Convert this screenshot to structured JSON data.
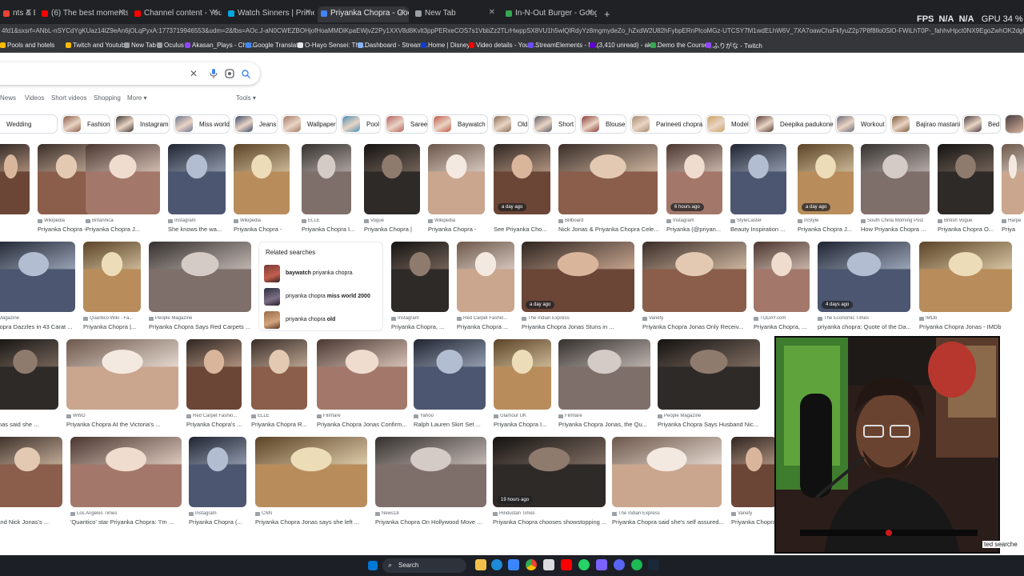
{
  "browser": {
    "tabs": [
      {
        "title": "nts & Boo",
        "color": "#ea4335",
        "active": false
      },
      {
        "title": "(6) The best moments from the",
        "color": "#ff0000",
        "active": false
      },
      {
        "title": "Channel content - YouTube Stu",
        "color": "#ff0000",
        "active": false
      },
      {
        "title": "Watch Sinners | Prime Video",
        "color": "#00a8e1",
        "active": false
      },
      {
        "title": "Priyanka Chopra - Google Sear",
        "color": "#4285f4",
        "active": true
      },
      {
        "title": "New Tab",
        "color": "#9aa0a6",
        "active": false
      },
      {
        "title": "In-N-Out Burger - Google Ma",
        "color": "#34a853",
        "active": false
      }
    ],
    "new_tab_glyph": "+",
    "fps_label": "FPS",
    "fps_value": "N/A",
    "fps_value2": "N/A",
    "gpu_label": "GPU",
    "gpu_value": "34 %",
    "url": "4fd1&sxsrf=ANbL-nSYCdYgKUaz14lZ9eAn6jOLqPyxA:1773719946553&udm=2&fbs=AOc.J-aN0CWEZBOHjofHoaMMDiKpaEWjvZ2Py1XXV8d8Kvlt3ppPERxeCOS7s1VbbZz2TLrHwppSX8VU1h5wlQlRdyYz8mgmydeZo_hZxdW2U82hFybpERnPlcoMGz-UTCSY7M1wdELhW6V_7XA7oawChsFkfyuZ2p7P8f8llo0SlO-FWiLhT0P-_fahhvHpct0NX9EgoZwhOK2dgF2K9Nl8u8b_MvHbkQ8q=Priyanka+Chopra&sa=X&sqi=2&ved=2ahUKE",
    "bookmarks": [
      {
        "label": "Pools and hotels",
        "color": "#fbbc04"
      },
      {
        "label": "Twitch and Youtub...",
        "color": "#fbbc04"
      },
      {
        "label": "New Tab",
        "color": "#9aa0a6"
      },
      {
        "label": "Oculus",
        "color": "#9aa0a6"
      },
      {
        "label": "Akasan_Plays - Chat...",
        "color": "#9146ff"
      },
      {
        "label": "Google Translate",
        "color": "#4285f4"
      },
      {
        "label": "O-Hayo Sensei: The...",
        "color": "#e8eaed"
      },
      {
        "label": "Dashboard - Stream...",
        "color": "#8ab4f8"
      },
      {
        "label": "Home | Disney+",
        "color": "#113ccf"
      },
      {
        "label": "Video details - YouT...",
        "color": "#ff0000"
      },
      {
        "label": "StreamElements - M...",
        "color": "#6c4ef5"
      },
      {
        "label": "(3,410 unread) - aka...",
        "color": "#6001d2"
      },
      {
        "label": "Demo the Course |...",
        "color": "#34a853"
      },
      {
        "label": "ふりがな - Twitch",
        "color": "#9146ff"
      }
    ]
  },
  "search": {
    "clear_icon": "close-icon",
    "mic_icon": "microphone-icon",
    "lens_icon": "lens-icon",
    "search_icon": "search-icon",
    "filters": [
      "News",
      "Videos",
      "Short videos",
      "Shopping",
      "More ▾"
    ],
    "tools": "Tools ▾",
    "chips": [
      "Wedding",
      "Fashion",
      "Instagram",
      "Miss world",
      "Jeans",
      "Wallpaper",
      "Pool",
      "Saree",
      "Baywatch",
      "Old",
      "Short",
      "Blouse",
      "Parineeti chopra",
      "Model",
      "Deepika padukone",
      "Workout",
      "Bajirao mastani",
      "Bed"
    ]
  },
  "results": {
    "row1": [
      {
        "src": "",
        "title": "",
        "badge": ""
      },
      {
        "src": "Wikipedia",
        "title": "Priyanka Chopra -",
        "badge": ""
      },
      {
        "src": "Britannica",
        "title": "Priyanka Chopra J...",
        "badge": ""
      },
      {
        "src": "Instagram",
        "title": "She knows the wa...",
        "badge": ""
      },
      {
        "src": "Wikipedia",
        "title": "Priyanka Chopra -",
        "badge": ""
      },
      {
        "src": "ELLE",
        "title": "Priyanka Chopra I...",
        "badge": ""
      },
      {
        "src": "Vogue",
        "title": "Priyanka Chopra |",
        "badge": ""
      },
      {
        "src": "Wikipedia",
        "title": "Priyanka Chopra -",
        "badge": ""
      },
      {
        "src": "",
        "title": "See Priyanka Cho...",
        "badge": "a day ago"
      },
      {
        "src": "Billboard",
        "title": "Nick Jonas & Priyanka Chopra Cele...",
        "badge": ""
      },
      {
        "src": "Instagram",
        "title": "Priyanka (@priyan...",
        "badge": "6 hours ago"
      },
      {
        "src": "StyleCaster",
        "title": "Beauty Inspiration ...",
        "badge": ""
      },
      {
        "src": "InStyle",
        "title": "Priyanka Chopra J...",
        "badge": "a day ago"
      },
      {
        "src": "South China Morning Post",
        "title": "How Priyanka Chopra ...",
        "badge": ""
      },
      {
        "src": "British Vogue",
        "title": "Priyanka Chopra O...",
        "badge": ""
      },
      {
        "src": "Harpe",
        "title": "Priya",
        "badge": ""
      }
    ],
    "row2": [
      {
        "src": "Magazine",
        "title": "Chopra Dazzles in 43 Carat ...",
        "badge": ""
      },
      {
        "src": "Quantico Wiki - Fa...",
        "title": "Priyanka Chopra |...",
        "badge": ""
      },
      {
        "src": "People Magazine",
        "title": "Priyanka Chopra Says Red Carpets ...",
        "badge": ""
      },
      {
        "src": "Instagram",
        "title": "Priyanka Chopra, ...",
        "badge": ""
      },
      {
        "src": "Red Carpet Fashio...",
        "title": "Priyanka Chopra ...",
        "badge": ""
      },
      {
        "src": "The Indian Express",
        "title": "Priyanka Chopra Jonas Stuns in ...",
        "badge": "a day ago"
      },
      {
        "src": "Variety",
        "title": "Priyanka Chopra Jonas Only Receiv...",
        "badge": ""
      },
      {
        "src": "TODAY.com",
        "title": "Priyanka Chopra, ...",
        "badge": ""
      },
      {
        "src": "The Economic Times",
        "title": "priyanka chopra: Quote of the Da...",
        "badge": "4 days ago"
      },
      {
        "src": "IMDb",
        "title": "Priyanka Chopra Jonas - IMDb",
        "badge": ""
      }
    ],
    "related": {
      "title": "Related searches",
      "items": [
        {
          "bold": "baywatch",
          "rest": " priyanka chopra"
        },
        {
          "pre": "priyanka chopra ",
          "bold": "miss world 2000"
        },
        {
          "pre": "priyanka chopra ",
          "bold": "old"
        }
      ]
    },
    "row3": [
      {
        "src": "",
        "title": "Jonas said she ...",
        "badge": ""
      },
      {
        "src": "WWD",
        "title": "Priyanka Chopra At the Victoria's ...",
        "badge": ""
      },
      {
        "src": "Red Carpet Fashio...",
        "title": "Priyanka Chopra's ...",
        "badge": ""
      },
      {
        "src": "ELLE",
        "title": "Priyanka Chopra R...",
        "badge": ""
      },
      {
        "src": "Filmfare",
        "title": "Priyanka Chopra Jonas Confirm...",
        "badge": ""
      },
      {
        "src": "Yahoo",
        "title": "Ralph Lauren Skirt Set ...",
        "badge": ""
      },
      {
        "src": "Glamour UK",
        "title": "Priyanka Chopra I...",
        "badge": ""
      },
      {
        "src": "Filmfare",
        "title": "Priyanka Chopra Jonas, the Qu...",
        "badge": ""
      },
      {
        "src": "People Magazine",
        "title": "Priyanka Chopra Says Husband Nic...",
        "badge": ""
      }
    ],
    "row4": [
      {
        "src": "",
        "title": "a and Nick Jonas's ...",
        "badge": ""
      },
      {
        "src": "Los Angeles Times",
        "title": "'Quantico' star Priyanka Chopra: 'I'm ...",
        "badge": ""
      },
      {
        "src": "Instagram",
        "title": "Priyanka Chopra (...",
        "badge": ""
      },
      {
        "src": "CNN",
        "title": "Priyanka Chopra Jonas says she left ...",
        "badge": ""
      },
      {
        "src": "News18",
        "title": "Priyanka Chopra On Hollywood Move ...",
        "badge": ""
      },
      {
        "src": "Hindustan Times",
        "title": "Priyanka Chopra chooses showstopping ...",
        "badge": "19 hours ago"
      },
      {
        "src": "The Indian Express",
        "title": "Priyanka Chopra said she's self assured...",
        "badge": ""
      },
      {
        "src": "Variety",
        "title": "Priyanka Chopra",
        "badge": ""
      }
    ],
    "related_peek": "ted searche"
  },
  "taskbar": {
    "search_label": "Search"
  }
}
